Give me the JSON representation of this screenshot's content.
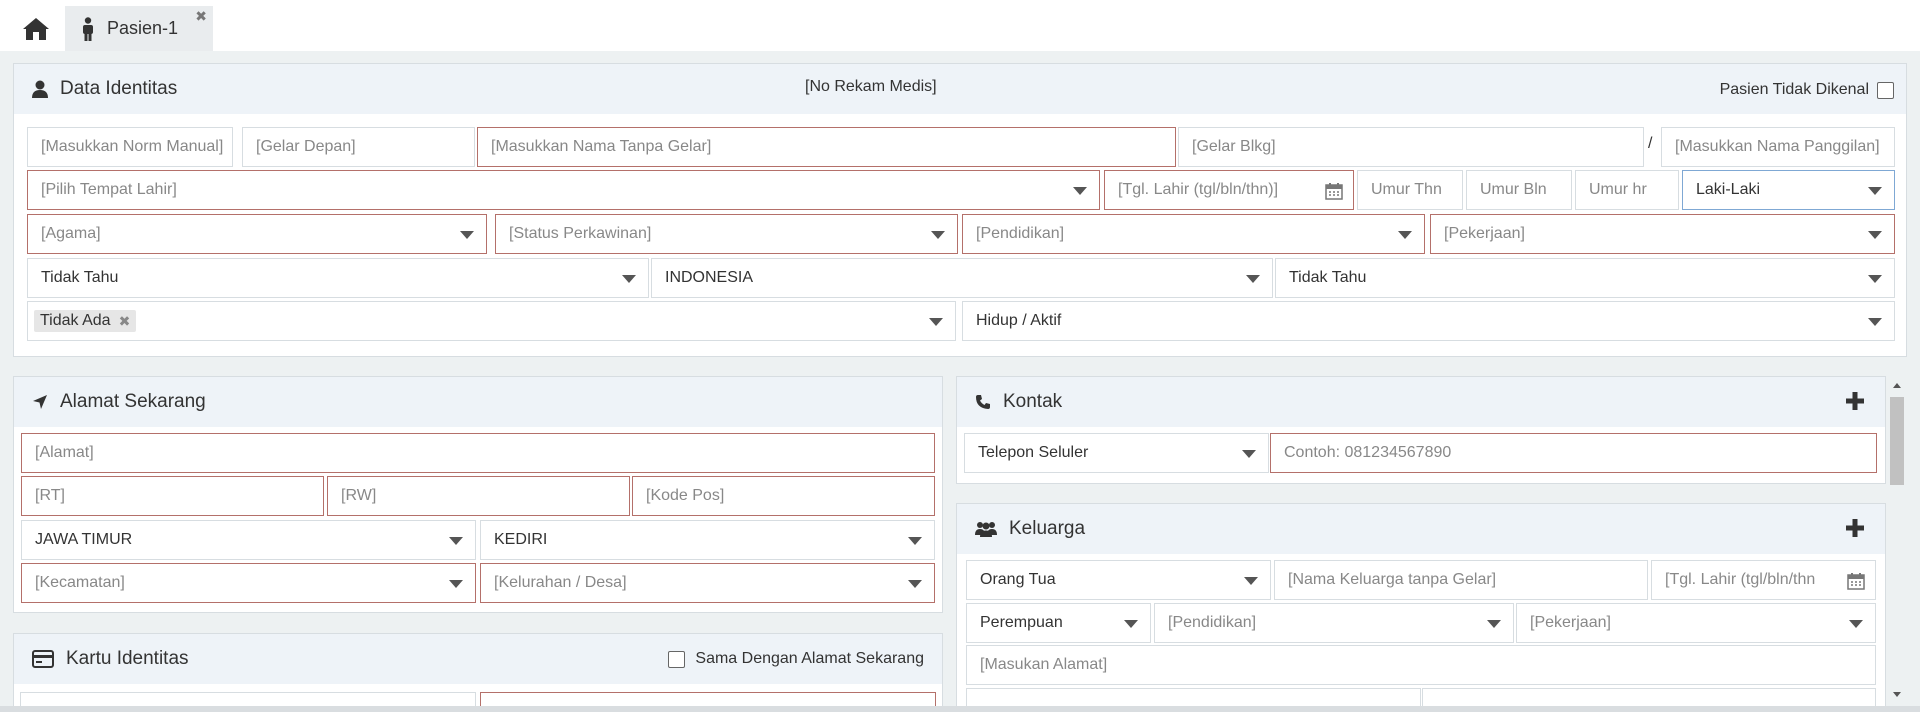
{
  "tabs": [
    {
      "label": "Pasien-1",
      "close": "✖"
    }
  ],
  "identitas": {
    "title": "Data Identitas",
    "rekam_medis": "[No Rekam Medis]",
    "pasien_tidak_dikenal": "Pasien Tidak Dikenal",
    "norm_manual": "[Masukkan Norm Manual]",
    "gelar_depan": "[Gelar Depan]",
    "nama": "[Masukkan Nama Tanpa Gelar]",
    "gelar_blkg": "[Gelar Blkg]",
    "slash": "/",
    "panggilan": "[Masukkan Nama Panggilan]",
    "tempat_lahir": "[Pilih Tempat Lahir]",
    "tgl_lahir": "[Tgl. Lahir (tgl/bln/thn)]",
    "umur_thn": "Umur Thn",
    "umur_bln": "Umur Bln",
    "umur_hr": "Umur hr",
    "jenis_kelamin": "Laki-Laki",
    "agama": "[Agama]",
    "status_perkawinan": "[Status Perkawinan]",
    "pendidikan": "[Pendidikan]",
    "pekerjaan": "[Pekerjaan]",
    "select_a": "Tidak Tahu",
    "kewarganegaraan": "INDONESIA",
    "select_b": "Tidak Tahu",
    "tag": "Tidak Ada",
    "tag_remove": "✖",
    "status_hidup": "Hidup / Aktif"
  },
  "alamat": {
    "title": "Alamat Sekarang",
    "alamat": "[Alamat]",
    "rt": "[RT]",
    "rw": "[RW]",
    "kode_pos": "[Kode Pos]",
    "provinsi": "JAWA TIMUR",
    "kabupaten": "KEDIRI",
    "kecamatan": "[Kecamatan]",
    "kelurahan": "[Kelurahan / Desa]"
  },
  "kartu": {
    "title": "Kartu Identitas",
    "sama_dengan": "Sama Dengan Alamat Sekarang"
  },
  "kontak": {
    "title": "Kontak",
    "jenis": "Telepon Seluler",
    "nomor": "Contoh: 081234567890"
  },
  "keluarga": {
    "title": "Keluarga",
    "hubungan": "Orang Tua",
    "nama": "[Nama Keluarga tanpa Gelar]",
    "tgl_lahir": "[Tgl. Lahir (tgl/bln/thn",
    "jenis_kelamin": "Perempuan",
    "pendidikan": "[Pendidikan]",
    "pekerjaan": "[Pekerjaan]",
    "alamat": "[Masukan Alamat]"
  },
  "colors": {
    "required_border": "#b4706a",
    "panel_header": "#eef3f8",
    "background": "#edf1f2"
  }
}
